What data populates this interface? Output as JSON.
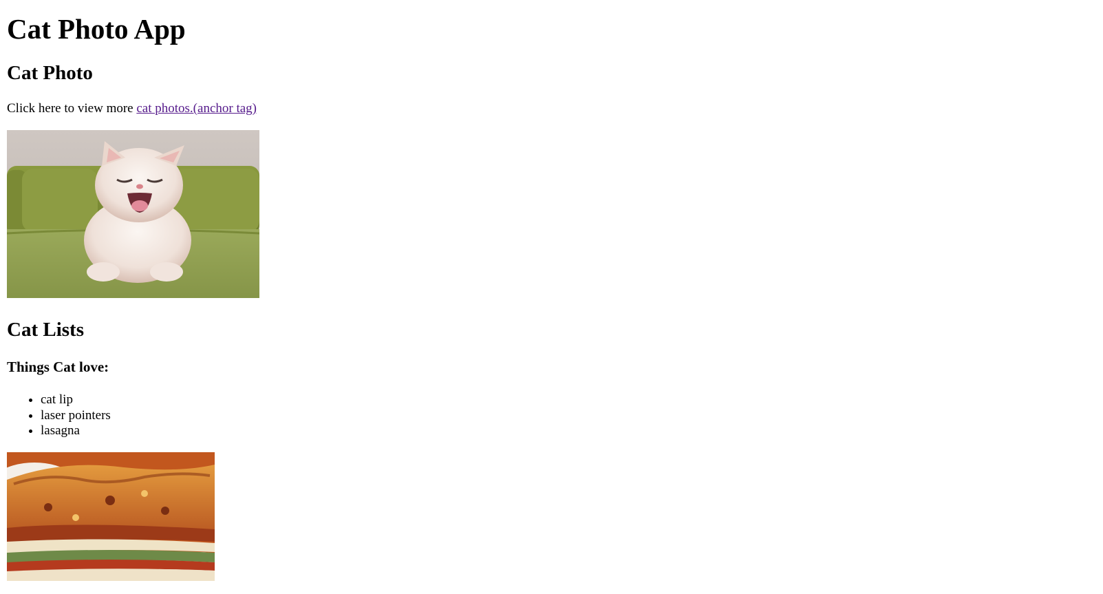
{
  "header": {
    "title": "Cat Photo App"
  },
  "cat_photo_section": {
    "heading": "Cat Photo",
    "intro_text": "Click here to view more ",
    "link_text": "cat photos.(anchor tag)"
  },
  "cat_lists_section": {
    "heading": "Cat Lists",
    "subheading": "Things Cat love:",
    "items": [
      "cat lip",
      "laser pointers",
      "lasagna"
    ]
  }
}
